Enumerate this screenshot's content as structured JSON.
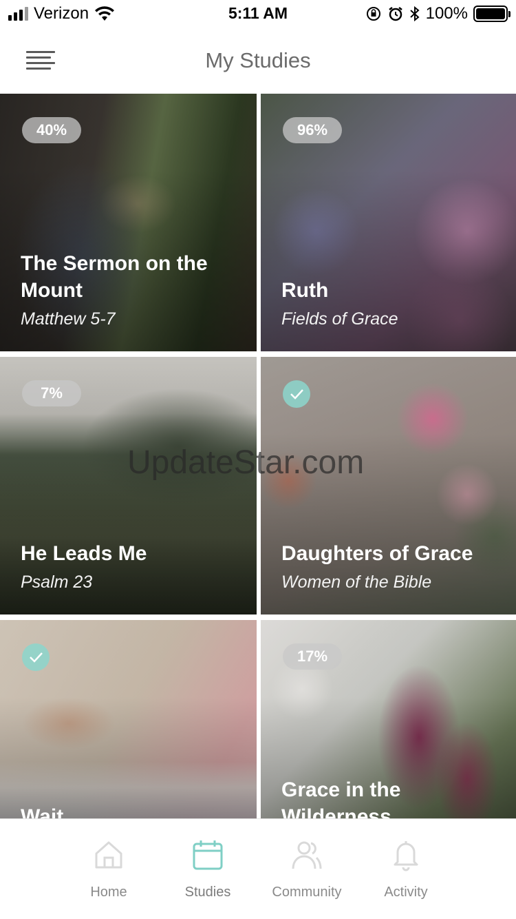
{
  "status_bar": {
    "carrier": "Verizon",
    "time": "5:11 AM",
    "battery": "100%"
  },
  "header": {
    "title": "My Studies"
  },
  "studies": [
    {
      "title": "The Sermon on the Mount",
      "subtitle": "Matthew 5-7",
      "progress": "40%",
      "completed": false
    },
    {
      "title": "Ruth",
      "subtitle": "Fields of Grace",
      "progress": "96%",
      "completed": false
    },
    {
      "title": "He Leads Me",
      "subtitle": "Psalm 23",
      "progress": "7%",
      "completed": false
    },
    {
      "title": "Daughters of Grace",
      "subtitle": "Women of the Bible",
      "progress": "",
      "completed": true
    },
    {
      "title": "Wait",
      "subtitle": "",
      "progress": "",
      "completed": true
    },
    {
      "title": "Grace in the Wilderness",
      "subtitle": "",
      "progress": "17%",
      "completed": false
    }
  ],
  "watermark": "UpdateStar.com",
  "tabs": [
    {
      "label": "Home",
      "icon": "home-icon"
    },
    {
      "label": "Studies",
      "icon": "calendar-icon",
      "active": true
    },
    {
      "label": "Community",
      "icon": "people-icon"
    },
    {
      "label": "Activity",
      "icon": "bell-icon"
    }
  ],
  "colors": {
    "accent": "#7fcfc5",
    "inactive_icon": "#d9d9d9"
  }
}
